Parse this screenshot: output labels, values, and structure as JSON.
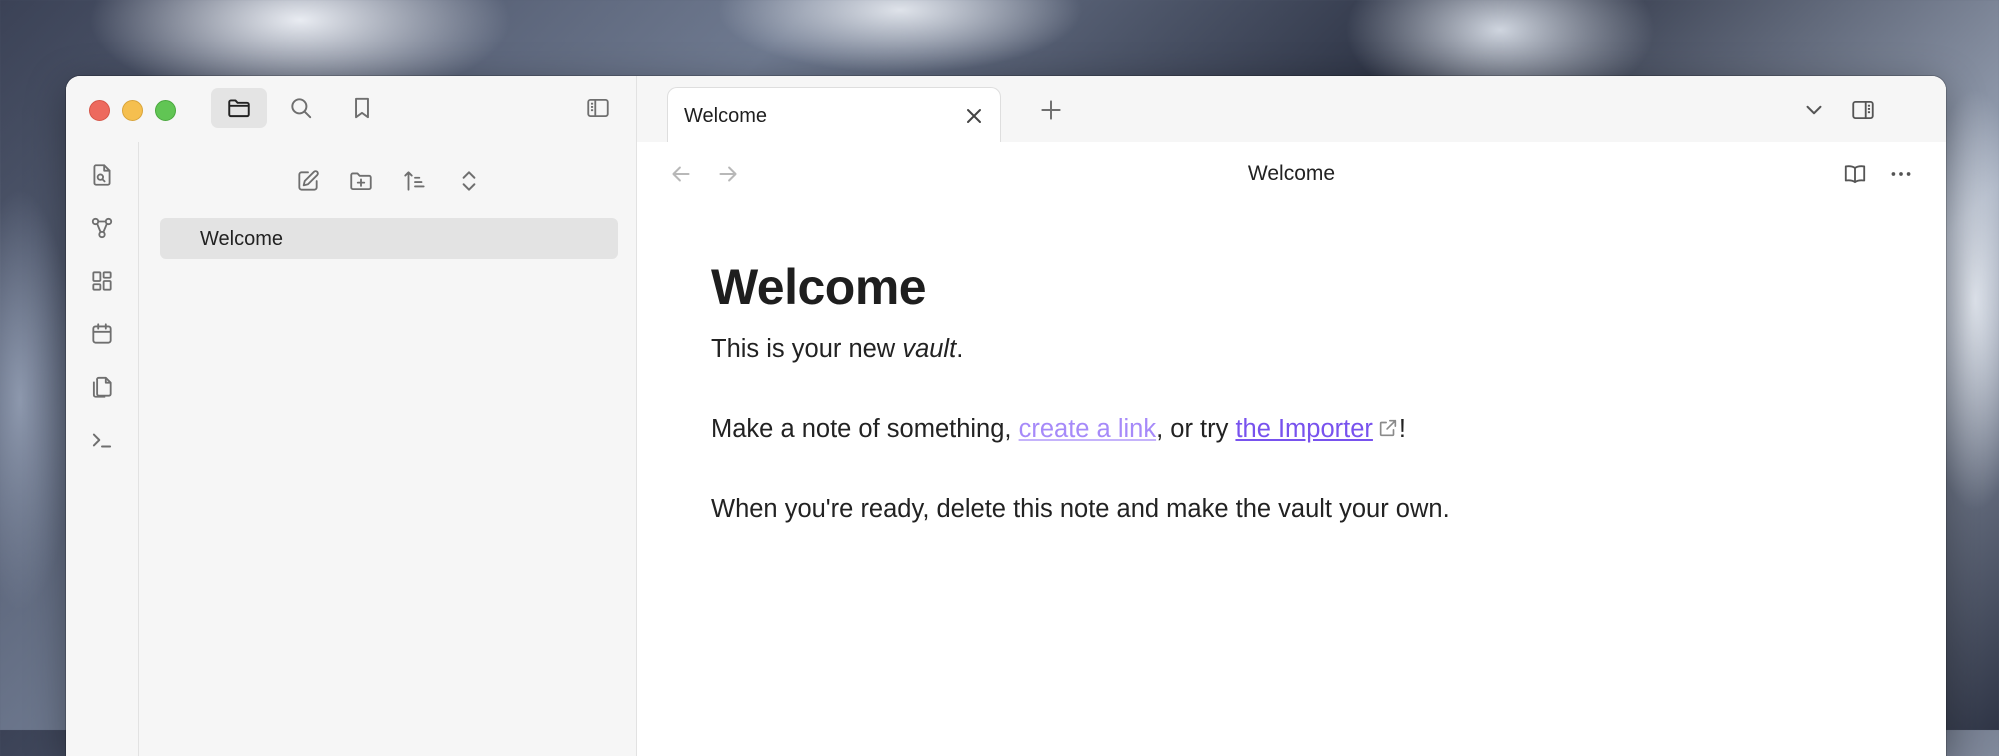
{
  "colors": {
    "accent": "#7852ee",
    "internal_link": "#a68af9",
    "sidebar_bg": "#f6f6f6",
    "selected_item_bg": "#e3e3e3",
    "icon_gray": "#6f6f6f",
    "traffic_red": "#ed6a5e",
    "traffic_yellow": "#f5bf4f",
    "traffic_green": "#61c554"
  },
  "titlebar": {
    "left_buttons": [
      "folder-icon",
      "search-icon",
      "bookmark-icon"
    ],
    "sidebar_toggle": "sidebar-left-icon"
  },
  "tabs": [
    {
      "label": "Welcome",
      "active": true
    }
  ],
  "tab_bar_icons": [
    "plus-icon",
    "chevron-down-icon",
    "sidebar-right-icon"
  ],
  "ribbon": {
    "icons": [
      "file-search-icon",
      "graph-icon",
      "layout-grid-icon",
      "calendar-icon",
      "files-copy-icon",
      "terminal-icon"
    ]
  },
  "file_explorer": {
    "toolbar_icons": [
      "new-note-icon",
      "new-folder-icon",
      "sort-icon",
      "collapse-icon"
    ],
    "files": [
      {
        "name": "Welcome",
        "selected": true
      }
    ]
  },
  "editor": {
    "view_title": "Welcome",
    "nav_icons": [
      "arrow-left-icon",
      "arrow-right-icon"
    ],
    "action_icons": [
      "reading-mode-icon",
      "more-options-icon"
    ],
    "heading": "Welcome",
    "p1_before": "This is your new ",
    "p1_em": "vault",
    "p1_after": ".",
    "p2_before": "Make a note of something, ",
    "p2_link1": "create a link",
    "p2_mid": ", or try ",
    "p2_link2": "the Importer",
    "p2_after": "!",
    "p3": "When you're ready, delete this note and make the vault your own."
  }
}
